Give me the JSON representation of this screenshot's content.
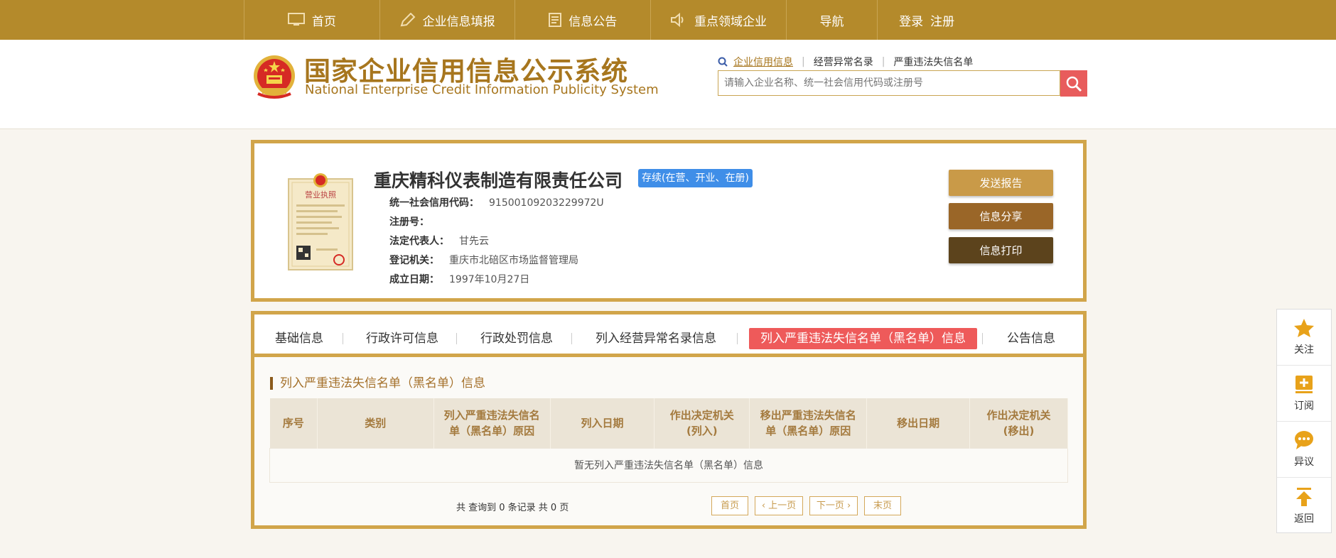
{
  "nav": {
    "items": [
      {
        "label": "首页",
        "icon": "monitor-icon"
      },
      {
        "label": "企业信息填报",
        "icon": "pen-icon"
      },
      {
        "label": "信息公告",
        "icon": "document-icon"
      },
      {
        "label": "重点领域企业",
        "icon": "speaker-icon"
      },
      {
        "label": "导航",
        "icon": ""
      }
    ],
    "login": "登录",
    "register": "注册"
  },
  "header": {
    "title_cn": "国家企业信用信息公示系统",
    "title_en": "National Enterprise Credit Information Publicity System"
  },
  "search": {
    "links": [
      "企业信用信息",
      "经营异常名录",
      "严重违法失信名单"
    ],
    "placeholder": "请输入企业名称、统一社会信用代码或注册号"
  },
  "company": {
    "name": "重庆精科仪表制造有限责任公司",
    "status": "存续(在营、开业、在册)",
    "license_title": "营业执照",
    "fields": [
      {
        "label": "统一社会信用代码：",
        "value": "91500109203229972U"
      },
      {
        "label": "注册号：",
        "value": ""
      },
      {
        "label": "法定代表人：",
        "value": "甘先云"
      },
      {
        "label": "登记机关：",
        "value": "重庆市北碚区市场监督管理局"
      },
      {
        "label": "成立日期：",
        "value": "1997年10月27日"
      }
    ],
    "buttons": {
      "send": "发送报告",
      "share": "信息分享",
      "print": "信息打印"
    }
  },
  "tabs": [
    "基础信息",
    "行政许可信息",
    "行政处罚信息",
    "列入经营异常名录信息",
    "列入严重违法失信名单（黑名单）信息",
    "公告信息"
  ],
  "section": {
    "title": "列入严重违法失信名单（黑名单）信息",
    "columns": [
      "序号",
      "类别",
      "列入严重违法失信名单（黑名单）原因",
      "列入日期",
      "作出决定机关(列入)",
      "移出严重违法失信名单（黑名单）原因",
      "移出日期",
      "作出决定机关(移出)"
    ],
    "empty_text": "暂无列入严重违法失信名单（黑名单）信息"
  },
  "pager": {
    "info": "共 查询到 0 条记录 共 0 页",
    "first": "首页",
    "prev": "上一页",
    "next": "下一页",
    "last": "末页"
  },
  "float_bar": [
    {
      "label": "关注",
      "icon": "star-icon"
    },
    {
      "label": "订阅",
      "icon": "subscribe-icon"
    },
    {
      "label": "异议",
      "icon": "chat-icon"
    },
    {
      "label": "返回",
      "icon": "arrow-up-icon"
    }
  ],
  "colors": {
    "brand": "#b48a2b",
    "card_border": "#d1a54a",
    "active_tab": "#ee5a5a",
    "status_badge": "#3f8ee8"
  }
}
